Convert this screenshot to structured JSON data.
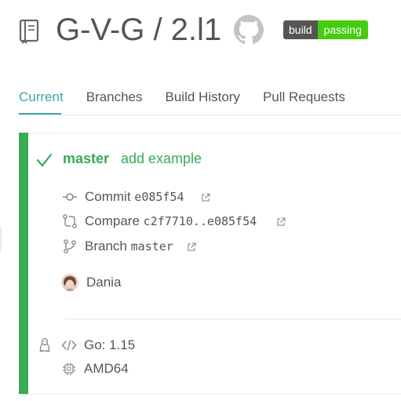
{
  "header": {
    "repo_title": "G-V-G / 2.l1",
    "repo_icon": "repository-book-icon",
    "github_icon": "github-octocat-icon",
    "badge": {
      "left": "build",
      "right": "passing",
      "left_color": "#555555",
      "right_color": "#44cc11"
    }
  },
  "tabs": [
    {
      "label": "Current",
      "active": true
    },
    {
      "label": "Branches",
      "active": false
    },
    {
      "label": "Build History",
      "active": false
    },
    {
      "label": "Pull Requests",
      "active": false
    }
  ],
  "colors": {
    "accent": "#39aaa4",
    "passed": "#39aa56",
    "text": "#555555"
  },
  "build": {
    "status_icon": "check-icon",
    "branch": "master",
    "message": "add example",
    "commit": {
      "label": "Commit",
      "value": "e085f54"
    },
    "compare": {
      "label": "Compare",
      "value": "c2f7710..e085f54"
    },
    "branch_link": {
      "label": "Branch",
      "value": "master"
    },
    "author": "Dania",
    "os_icon": "linux-tux-icon",
    "language": {
      "label": "Go: 1.15"
    },
    "arch": {
      "label": "AMD64"
    }
  }
}
